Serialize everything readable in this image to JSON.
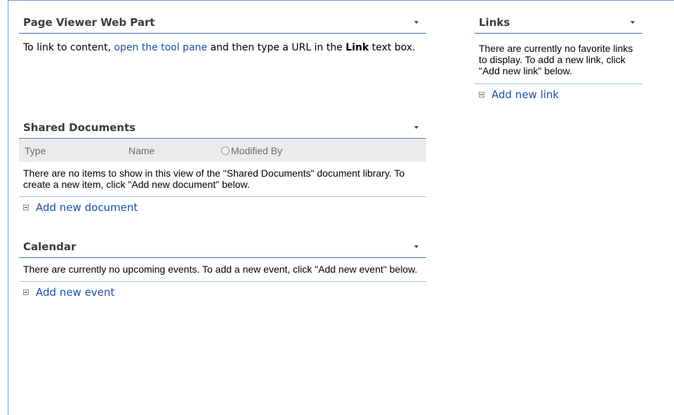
{
  "page_viewer": {
    "title": "Page Viewer Web Part",
    "text_before": "To link to content, ",
    "link": "open the tool pane",
    "text_middle": " and then type a URL in the ",
    "bold": "Link",
    "text_after": " text box."
  },
  "shared_documents": {
    "title": "Shared Documents",
    "columns": [
      "Type",
      "Name",
      "Modified By"
    ],
    "message": "There are no items to show in this view of the \"Shared Documents\" document library. To create a new item, click \"Add new document\" below.",
    "add_label": "Add new document"
  },
  "calendar": {
    "title": "Calendar",
    "message": "There are currently no upcoming events. To add a new event, click \"Add new event\" below.",
    "add_label": "Add new event"
  },
  "links": {
    "title": "Links",
    "message": "There are currently no favorite links to display. To add a new link, click \"Add new link\" below.",
    "add_label": "Add new link"
  },
  "colors": {
    "link": "#1f4fa8",
    "title_rule": "#3b6fb8",
    "frame": "#6f9ad6",
    "header_bg": "#ebebeb"
  }
}
